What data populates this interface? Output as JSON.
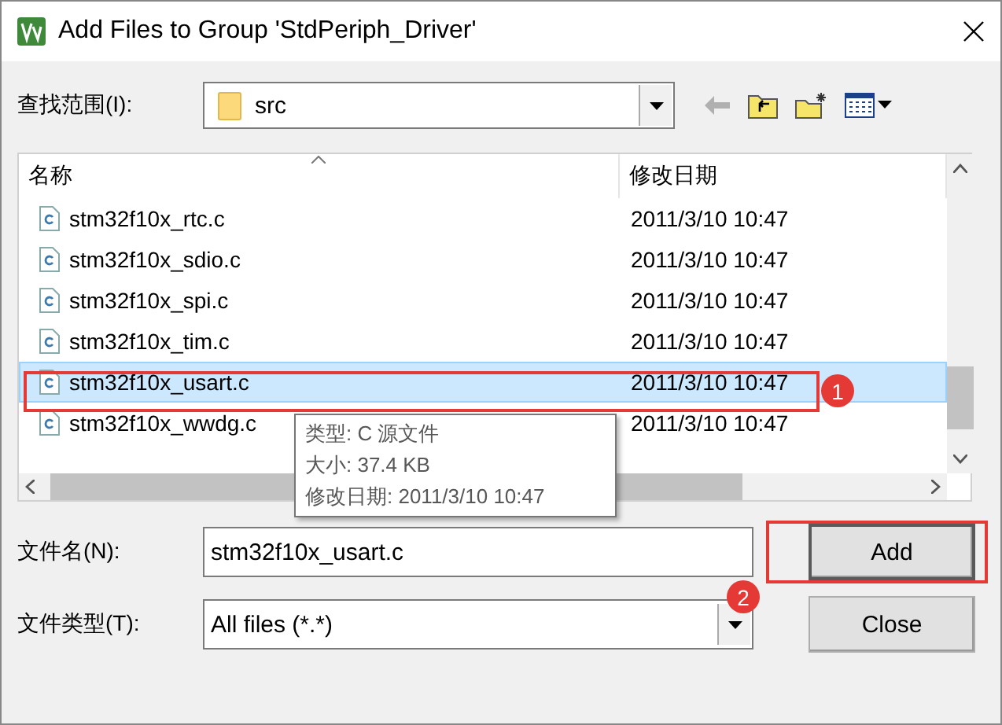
{
  "window": {
    "title": "Add Files to Group 'StdPeriph_Driver'"
  },
  "look_in": {
    "label": "查找范围(I):",
    "value": "src"
  },
  "columns": [
    "名称",
    "修改日期"
  ],
  "rows": [
    {
      "name": "stm32f10x_rtc.c",
      "date": "2011/3/10 10:47",
      "selected": false
    },
    {
      "name": "stm32f10x_sdio.c",
      "date": "2011/3/10 10:47",
      "selected": false
    },
    {
      "name": "stm32f10x_spi.c",
      "date": "2011/3/10 10:47",
      "selected": false
    },
    {
      "name": "stm32f10x_tim.c",
      "date": "2011/3/10 10:47",
      "selected": false
    },
    {
      "name": "stm32f10x_usart.c",
      "date": "2011/3/10 10:47",
      "selected": true
    },
    {
      "name": "stm32f10x_wwdg.c",
      "date": "2011/3/10 10:47",
      "selected": false
    }
  ],
  "tooltip": [
    "类型: C 源文件",
    "大小: 37.4 KB",
    "修改日期: 2011/3/10 10:47"
  ],
  "file_name": {
    "label": "文件名(N):",
    "value": "stm32f10x_usart.c"
  },
  "file_type": {
    "label": "文件类型(T):",
    "value": "All files (*.*)"
  },
  "buttons": [
    {
      "label": "Add",
      "kind": "default"
    },
    {
      "label": "Close",
      "kind": "normal"
    }
  ],
  "annotations": [
    {
      "label": "1",
      "kind": "row"
    },
    {
      "label": "2",
      "kind": "button"
    }
  ]
}
